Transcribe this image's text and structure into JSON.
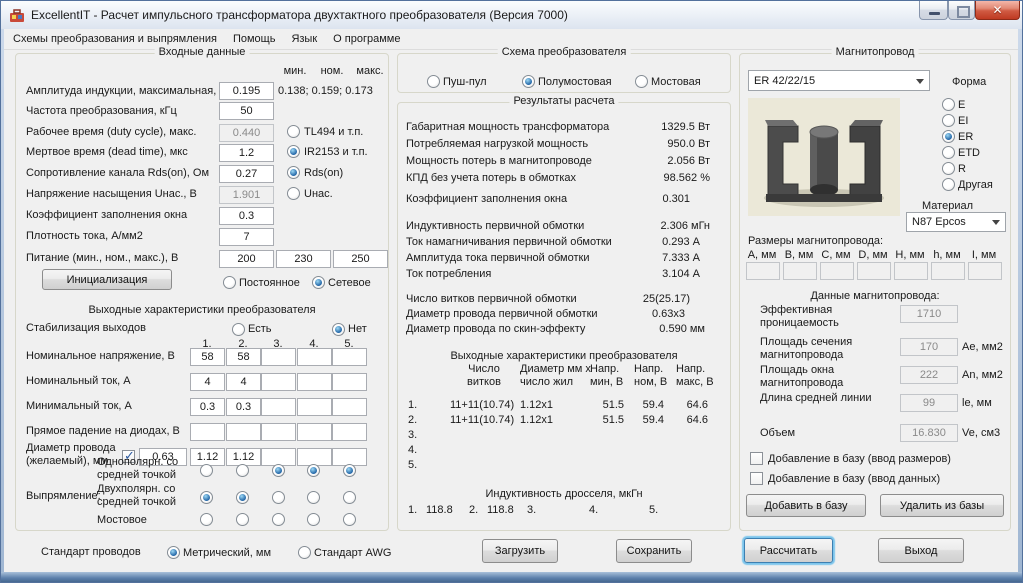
{
  "window": {
    "title": "ExcellentIT - Расчет импульсного трансформатора двухтактного преобразователя (Версия 7000)",
    "icons": {
      "app": "app-icon",
      "minimize": "minimize-icon",
      "maximize": "maximize-icon",
      "close": "close-icon"
    }
  },
  "menu": {
    "items": [
      "Схемы преобразования и выпрямления",
      "Помощь",
      "Язык",
      "О программе"
    ]
  },
  "inputs": {
    "title": "Входные данные",
    "col_min": "мин.",
    "col_nom": "ном.",
    "col_max": "макс.",
    "rows": [
      {
        "label": "Амплитуда индукции, максимальная, Т",
        "value": "0.195",
        "extra": "0.138; 0.159; 0.173"
      },
      {
        "label": "Частота преобразования, кГц",
        "value": "50"
      },
      {
        "label": "Рабочее время (duty cycle), макс.",
        "value": "0.440",
        "radio": {
          "label": "TL494 и т.п.",
          "checked": false
        }
      },
      {
        "label": "Мертвое время (dead time), мкс",
        "value": "1.2",
        "radio": {
          "label": "IR2153 и т.п.",
          "checked": true
        }
      },
      {
        "label": "Сопротивление канала Rds(on), Ом",
        "value": "0.27",
        "radio": {
          "label": "Rds(on)",
          "checked": true
        }
      },
      {
        "label": "Напряжение насыщения Uнас., В",
        "value": "1.901",
        "radio": {
          "label": "Uнас.",
          "checked": false
        }
      },
      {
        "label": "Коэффициент заполнения окна",
        "value": "0.3"
      },
      {
        "label": "Плотность тока, А/мм2",
        "value": "7"
      }
    ],
    "supply": {
      "label": "Питание (мин., ном., макс.), В",
      "values": [
        "200",
        "230",
        "250"
      ]
    },
    "init_button": "Инициализация",
    "dc": {
      "label": "Постоянное",
      "checked": false
    },
    "ac": {
      "label": "Сетевое",
      "checked": true
    }
  },
  "outputs": {
    "title": "Выходные характеристики преобразователя",
    "stab_label": "Стабилизация выходов",
    "stab_yes": {
      "label": "Есть",
      "checked": false
    },
    "stab_no": {
      "label": "Нет",
      "checked": true
    },
    "col_headers": [
      "1.",
      "2.",
      "3.",
      "4.",
      "5."
    ],
    "rows": [
      {
        "label": "Номинальное напряжение, В",
        "values": [
          "58",
          "58",
          "",
          "",
          ""
        ]
      },
      {
        "label": "Номинальный ток, А",
        "values": [
          "4",
          "4",
          "",
          "",
          ""
        ]
      },
      {
        "label": "Минимальный ток, А",
        "values": [
          "0.3",
          "0.3",
          "",
          "",
          ""
        ]
      },
      {
        "label": "Прямое падение на диодах, В",
        "values": [
          "",
          "",
          "",
          "",
          ""
        ]
      }
    ],
    "diameter": {
      "label": "Диаметр провода (желаемый), мм",
      "checkbox_checked": true,
      "desired": "0.63",
      "values": [
        "1.12",
        "1.12",
        "",
        "",
        ""
      ]
    },
    "rect_label": "Выпрямление:",
    "rect_rows": [
      {
        "label": "Однополярн. со средней точкой",
        "checked": [
          false,
          false,
          true,
          true,
          true
        ]
      },
      {
        "label": "Двухполярн. со средней точкой",
        "checked": [
          true,
          true,
          false,
          false,
          false
        ]
      },
      {
        "label": "Мостовое",
        "checked": [
          false,
          false,
          false,
          false,
          false
        ]
      }
    ]
  },
  "wire_standard": {
    "label": "Стандарт проводов",
    "metric": {
      "label": "Метрический, мм",
      "checked": true
    },
    "awg": {
      "label": "Стандарт AWG",
      "checked": false
    }
  },
  "scheme": {
    "title": "Схема преобразователя",
    "options": [
      {
        "label": "Пуш-пул",
        "checked": false
      },
      {
        "label": "Полумостовая",
        "checked": true
      },
      {
        "label": "Мостовая",
        "checked": false
      }
    ]
  },
  "results": {
    "title": "Результаты расчета",
    "items": [
      {
        "label": "Габаритная мощность трансформатора",
        "value": "1329.5 Вт"
      },
      {
        "label": "Потребляемая нагрузкой мощность",
        "value": "950.0 Вт"
      },
      {
        "label": "Мощность потерь в магнитопроводе",
        "value": "2.056 Вт"
      },
      {
        "label": "КПД без учета потерь в обмотках",
        "value": "98.562 %"
      },
      {
        "label": "Коэффициент заполнения окна",
        "value": "0.301"
      },
      {
        "label": "Индуктивность первичной обмотки",
        "value": "2.306 мГн"
      },
      {
        "label": "Ток намагничивания первичной обмотки",
        "value": "0.293 А"
      },
      {
        "label": "Амплитуда тока первичной обмотки",
        "value": "7.333 А"
      },
      {
        "label": "Ток потребления",
        "value": "3.104 А"
      },
      {
        "label": "Число витков первичной обмотки",
        "value": "25(25.17)"
      },
      {
        "label": "Диаметр провода первичной обмотки",
        "value": "0.63x3"
      },
      {
        "label": "Диаметр провода по скин-эффекту",
        "value": "0.590 мм"
      }
    ],
    "out_table": {
      "title": "Выходные характеристики преобразователя",
      "headers": [
        "Число витков",
        "Диаметр мм х число жил",
        "Напр. мин, В",
        "Напр. ном, В",
        "Напр. макс, В"
      ],
      "rows": [
        {
          "n": "1.",
          "turns": "11+11(10.74)",
          "wire": "1.12x1",
          "umin": "51.5",
          "unom": "59.4",
          "umax": "64.6"
        },
        {
          "n": "2.",
          "turns": "11+11(10.74)",
          "wire": "1.12x1",
          "umin": "51.5",
          "unom": "59.4",
          "umax": "64.6"
        },
        {
          "n": "3.",
          "turns": "",
          "wire": "",
          "umin": "",
          "unom": "",
          "umax": ""
        },
        {
          "n": "4.",
          "turns": "",
          "wire": "",
          "umin": "",
          "unom": "",
          "umax": ""
        },
        {
          "n": "5.",
          "turns": "",
          "wire": "",
          "umin": "",
          "unom": "",
          "umax": ""
        }
      ]
    },
    "choke": {
      "title": "Индуктивность дросселя, мкГн",
      "items": [
        {
          "n": "1.",
          "v": "118.8"
        },
        {
          "n": "2.",
          "v": "118.8"
        },
        {
          "n": "3.",
          "v": ""
        },
        {
          "n": "4.",
          "v": ""
        },
        {
          "n": "5.",
          "v": ""
        }
      ]
    }
  },
  "core": {
    "title": "Магнитопровод",
    "type_combo": "ER 42/22/15",
    "shape_label": "Форма",
    "shapes": [
      {
        "label": "E",
        "checked": false
      },
      {
        "label": "EI",
        "checked": false
      },
      {
        "label": "ER",
        "checked": true
      },
      {
        "label": "ETD",
        "checked": false
      },
      {
        "label": "R",
        "checked": false
      },
      {
        "label": "Другая",
        "checked": false
      }
    ],
    "material_label": "Материал",
    "material_combo": "N87 Epcos",
    "dims_label": "Размеры магнитопровода:",
    "dims": [
      "А, мм",
      "В, мм",
      "С, мм",
      "D, мм",
      "Н, мм",
      "h, мм",
      "I, мм"
    ],
    "data_label": "Данные магнитопровода:",
    "data_rows": [
      {
        "label": "Эффективная проницаемость",
        "value": "1710",
        "unit": ""
      },
      {
        "label": "Площадь сечения магнитопровода",
        "value": "170",
        "unit": "Ае, мм2"
      },
      {
        "label": "Площадь окна магнитопровода",
        "value": "222",
        "unit": "Аn, мм2"
      },
      {
        "label": "Длина средней линии",
        "value": "99",
        "unit": "le, мм"
      },
      {
        "label": "Объем",
        "value": "16.830",
        "unit": "Ve, см3"
      }
    ],
    "add_dims_checkbox": {
      "label": "Добавление в базу (ввод размеров)",
      "checked": false
    },
    "add_data_checkbox": {
      "label": "Добавление в базу (ввод данных)",
      "checked": false
    },
    "add_button": "Добавить в базу",
    "remove_button": "Удалить из базы"
  },
  "footer": {
    "load": "Загрузить",
    "save": "Сохранить",
    "calc": "Рассчитать",
    "exit": "Выход"
  }
}
